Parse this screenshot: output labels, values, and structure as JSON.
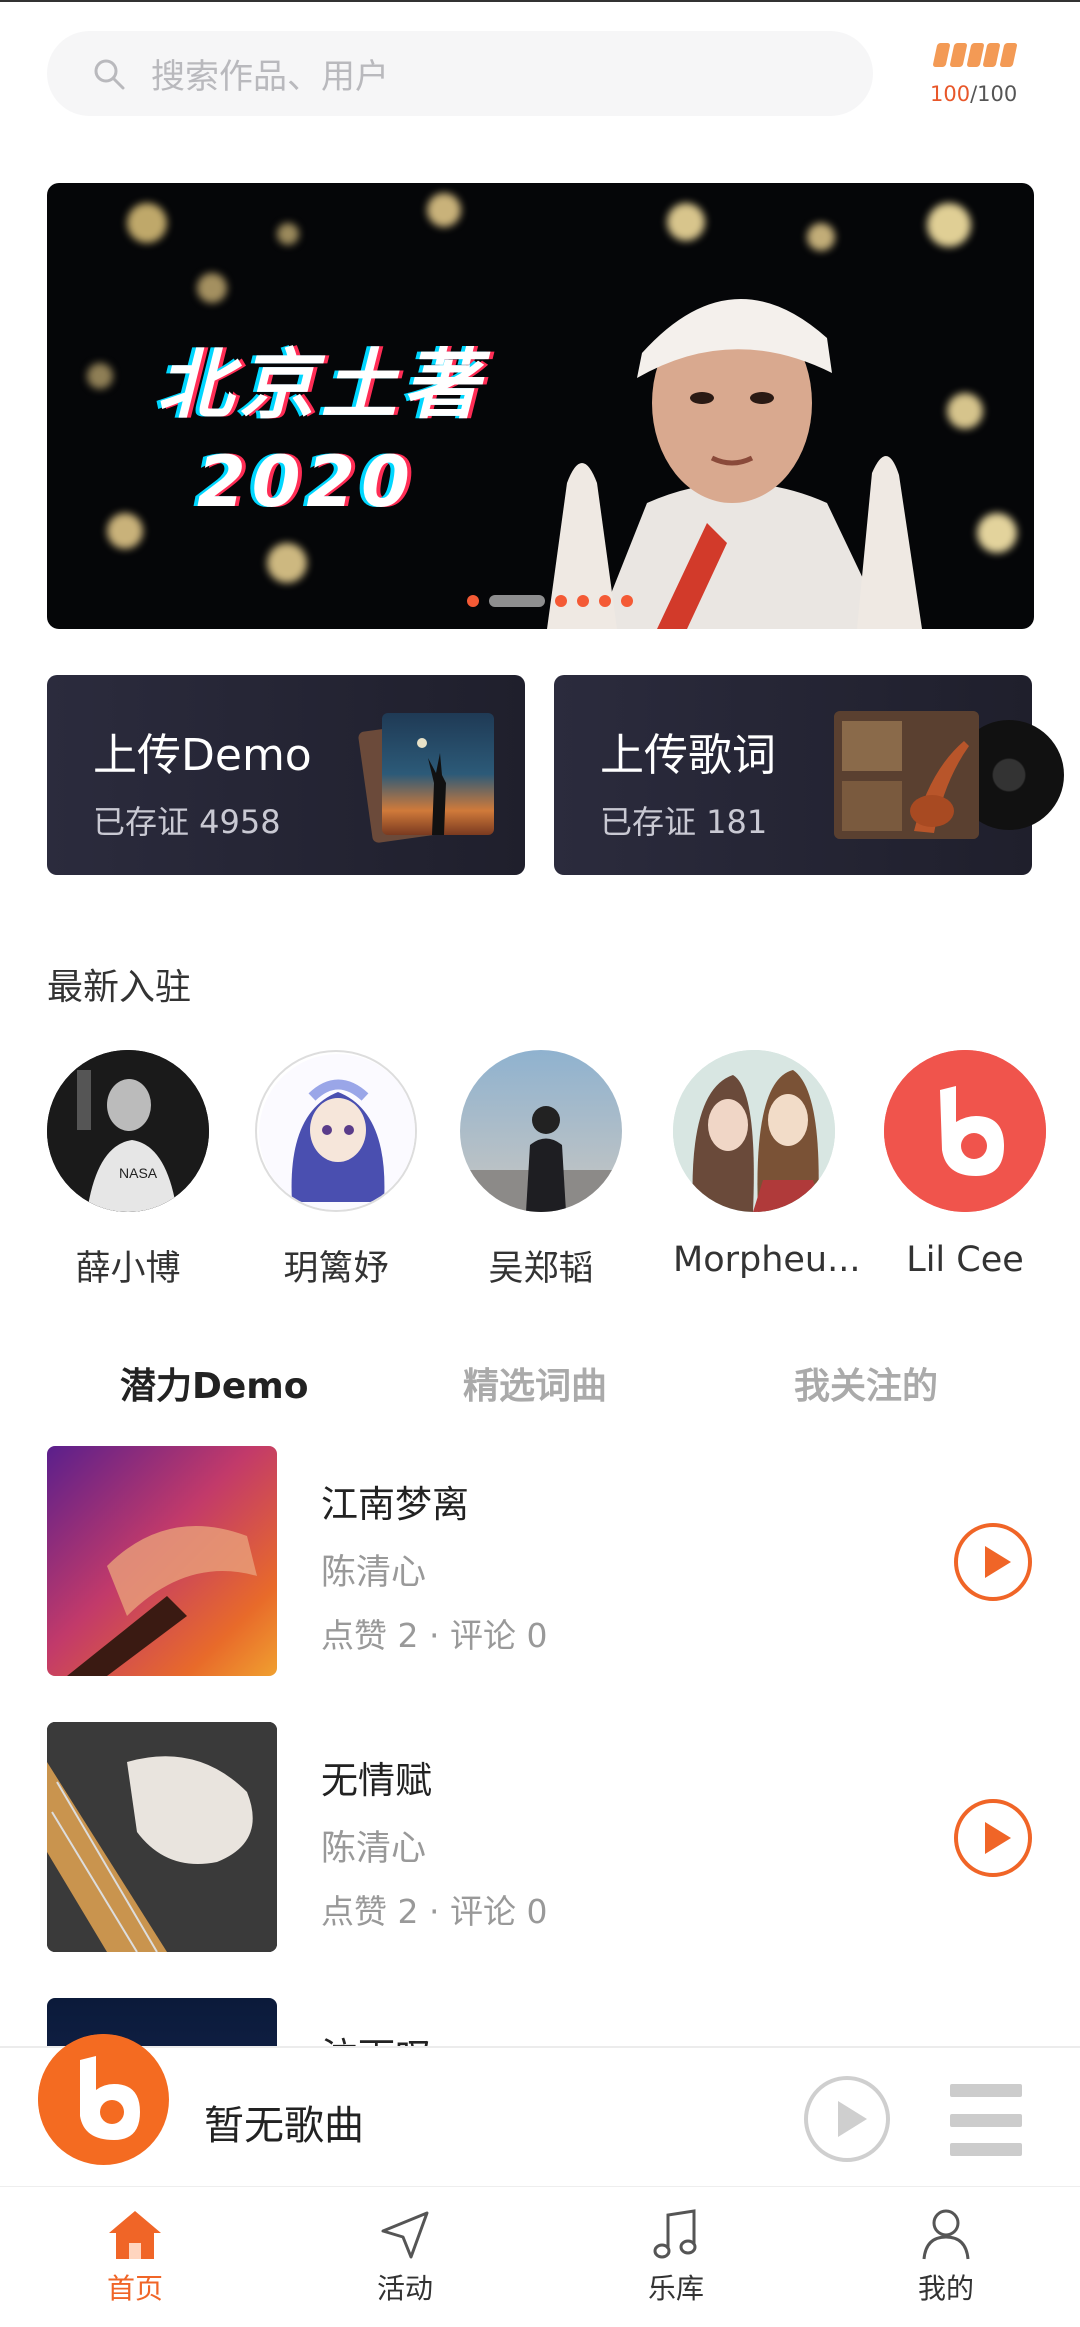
{
  "search": {
    "placeholder": "搜索作品、用户"
  },
  "quota": {
    "current": "100",
    "total": "/100"
  },
  "banner": {
    "line1": "北京土著",
    "line2": "2020",
    "slide_count": 6,
    "active_slide": 2
  },
  "cards": [
    {
      "title": "上传Demo",
      "subtitle": "已存证 4958"
    },
    {
      "title": "上传歌词",
      "subtitle": "已存证 181"
    }
  ],
  "section": {
    "new_artists": "最新入驻"
  },
  "artists": [
    {
      "name": "薛小博"
    },
    {
      "name": "玥篱妤"
    },
    {
      "name": "吴郑韬"
    },
    {
      "name": "Morpheu..."
    },
    {
      "name": "Lil Cee"
    }
  ],
  "tabs": [
    {
      "label": "潜力Demo",
      "active": true
    },
    {
      "label": "精选词曲",
      "active": false
    },
    {
      "label": "我关注的",
      "active": false
    }
  ],
  "songs": [
    {
      "title": "江南梦离",
      "artist": "陈清心",
      "stats": "点赞 2 · 评论 0"
    },
    {
      "title": "无情赋",
      "artist": "陈清心",
      "stats": "点赞 2 · 评论 0"
    },
    {
      "title": "泣雨叹",
      "artist": "",
      "stats": ""
    }
  ],
  "player": {
    "title": "暂无歌曲"
  },
  "nav": [
    {
      "label": "首页",
      "icon": "home-icon",
      "active": true
    },
    {
      "label": "活动",
      "icon": "send-icon",
      "active": false
    },
    {
      "label": "乐库",
      "icon": "music-note-icon",
      "active": false
    },
    {
      "label": "我的",
      "icon": "person-icon",
      "active": false
    }
  ],
  "colors": {
    "accent": "#f06527",
    "card_bg": "#2b2b3d",
    "battery": "#f39a55"
  }
}
